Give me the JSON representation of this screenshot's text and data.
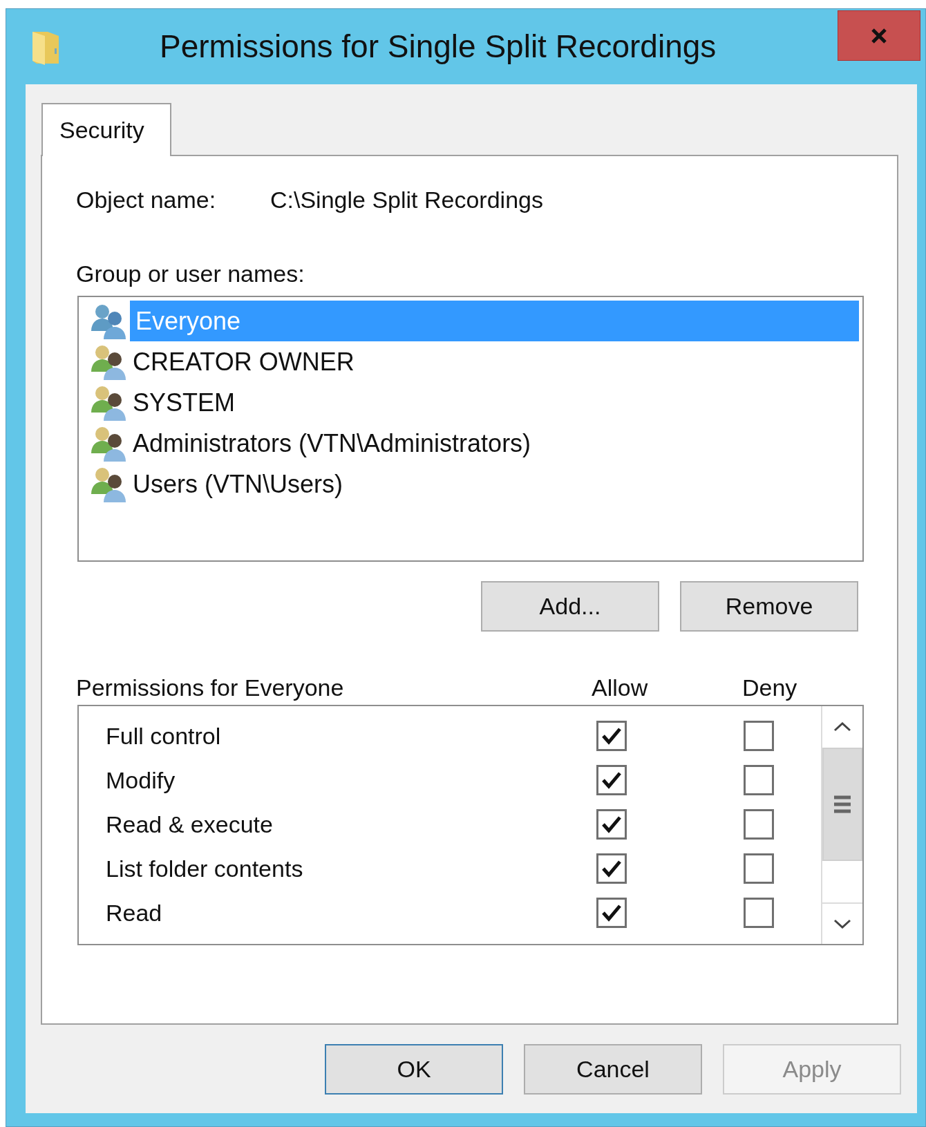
{
  "window": {
    "title": "Permissions for Single Split Recordings"
  },
  "tabs": [
    {
      "label": "Security",
      "selected": true
    }
  ],
  "object_name": {
    "label": "Object name:",
    "value": "C:\\Single Split Recordings"
  },
  "groups": {
    "label": "Group or user names:",
    "items": [
      {
        "name": "Everyone",
        "selected": true
      },
      {
        "name": "CREATOR OWNER",
        "selected": false
      },
      {
        "name": "SYSTEM",
        "selected": false
      },
      {
        "name": "Administrators (VTN\\Administrators)",
        "selected": false
      },
      {
        "name": "Users (VTN\\Users)",
        "selected": false
      }
    ]
  },
  "group_buttons": [
    "Add...",
    "Remove"
  ],
  "permissions": {
    "label": "Permissions for Everyone",
    "allow_heading": "Allow",
    "deny_heading": "Deny",
    "rows": [
      {
        "name": "Full control",
        "allow": true,
        "deny": false
      },
      {
        "name": "Modify",
        "allow": true,
        "deny": false
      },
      {
        "name": "Read & execute",
        "allow": true,
        "deny": false
      },
      {
        "name": "List folder contents",
        "allow": true,
        "deny": false
      },
      {
        "name": "Read",
        "allow": true,
        "deny": false
      }
    ]
  },
  "dialog_buttons": [
    {
      "label": "OK",
      "default": true,
      "disabled": false
    },
    {
      "label": "Cancel",
      "default": false,
      "disabled": false
    },
    {
      "label": "Apply",
      "default": false,
      "disabled": true
    }
  ]
}
